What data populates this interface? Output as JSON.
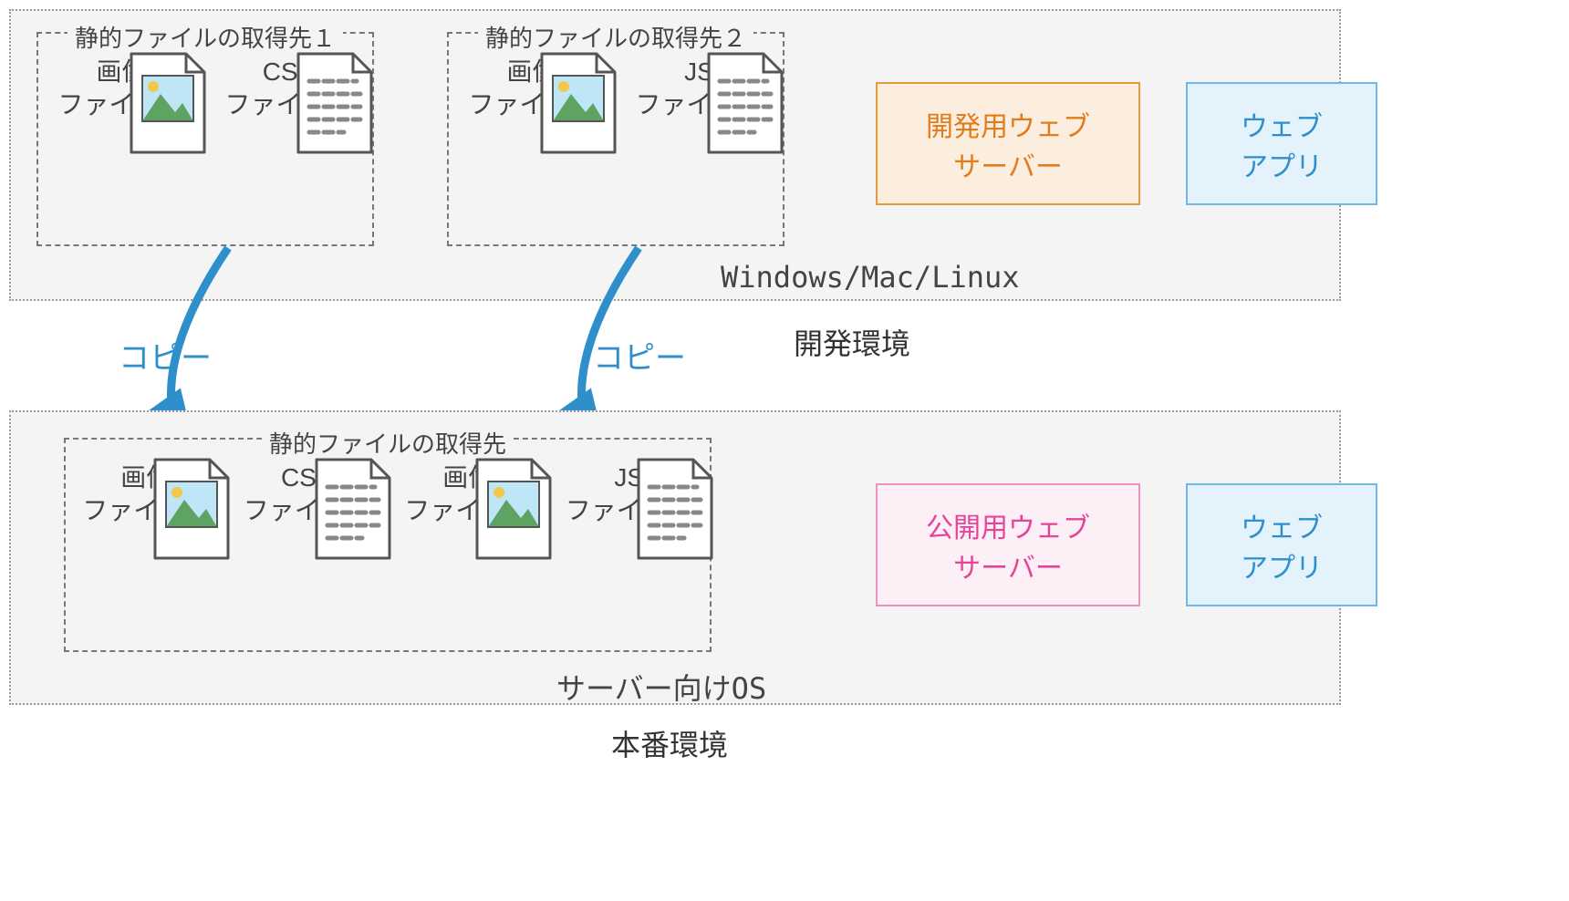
{
  "dev": {
    "group1_legend": "静的ファイルの取得先１",
    "group2_legend": "静的ファイルの取得先２",
    "group1_files": [
      {
        "type": "image",
        "line1": "画像",
        "line2": "ファイル１"
      },
      {
        "type": "text",
        "line1": "CSS",
        "line2": "ファイル１"
      }
    ],
    "group2_files": [
      {
        "type": "image",
        "line1": "画像",
        "line2": "ファイル２"
      },
      {
        "type": "text",
        "line1": "JS",
        "line2": "ファイル１"
      }
    ],
    "os_label": "Windows/Mac/Linux",
    "env_label": "開発環境",
    "server_label": "開発用ウェブ\nサーバー",
    "app_label": "ウェブ\nアプリ"
  },
  "copy": {
    "label1": "コピー",
    "label2": "コピー"
  },
  "prod": {
    "group_legend": "静的ファイルの取得先",
    "files": [
      {
        "type": "image",
        "line1": "画像",
        "line2": "ファイル１"
      },
      {
        "type": "text",
        "line1": "CSS",
        "line2": "ファイル１"
      },
      {
        "type": "image",
        "line1": "画像",
        "line2": "ファイル２"
      },
      {
        "type": "text",
        "line1": "JS",
        "line2": "ファイル１"
      }
    ],
    "os_label": "サーバー向けOS",
    "env_label": "本番環境",
    "server_label": "公開用ウェブ\nサーバー",
    "app_label": "ウェブ\nアプリ"
  }
}
